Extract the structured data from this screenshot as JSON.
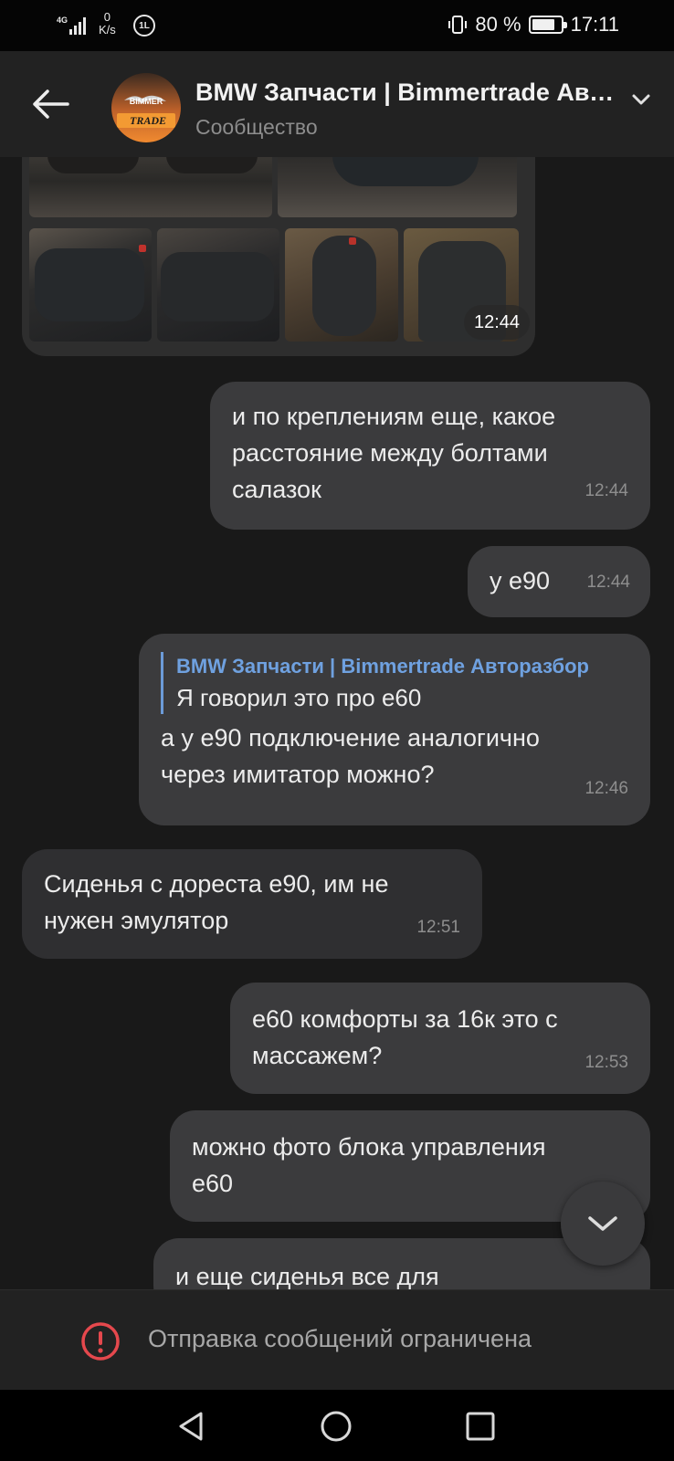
{
  "status_bar": {
    "network": "4G",
    "speed_value": "0",
    "speed_unit": "K/s",
    "net_badge": "1L",
    "battery": "80 %",
    "battery_level": 0.8,
    "time": "17:11"
  },
  "header": {
    "title": "BMW Запчасти | Bimmertrade Авторазбор",
    "subtitle": "Сообщество",
    "avatar_text_top": "BIMMER",
    "avatar_text_bottom": "TRADE"
  },
  "photo_album": {
    "time": "12:44"
  },
  "messages": [
    {
      "direction": "out",
      "lines": [
        "и по креплениям еще, какое",
        "расстояние между болтами",
        "салазок"
      ],
      "time": "12:44"
    },
    {
      "direction": "out",
      "lines": [
        "у е90"
      ],
      "time": "12:44"
    },
    {
      "direction": "out",
      "reply_author": "BMW Запчасти | Bimmertrade Авторазбор",
      "reply_text": "Я говорил это про е60",
      "lines": [
        "а у е90 подключение аналогично",
        "через имитатор можно?"
      ],
      "time": "12:46"
    },
    {
      "direction": "in",
      "lines": [
        "Сиденья с дореста е90, им не",
        "нужен эмулятор"
      ],
      "time": "12:51"
    },
    {
      "direction": "out",
      "lines": [
        "е60 комфорты за 16к это с",
        "массажем?"
      ],
      "time": "12:53"
    },
    {
      "direction": "out",
      "lines": [
        "можно фото блока управления",
        "е60"
      ],
      "time": ""
    },
    {
      "direction": "out",
      "lines": [
        "и еще сиденья все для"
      ],
      "time": ""
    }
  ],
  "restricted_notice": "Отправка сообщений ограничена",
  "colors": {
    "background": "#191919",
    "header": "#222222",
    "bubble_out": "#3b3b3d",
    "bubble_in": "#2f2f31",
    "reply_accent": "#6fa1e0",
    "alert_red": "#e5484d"
  }
}
